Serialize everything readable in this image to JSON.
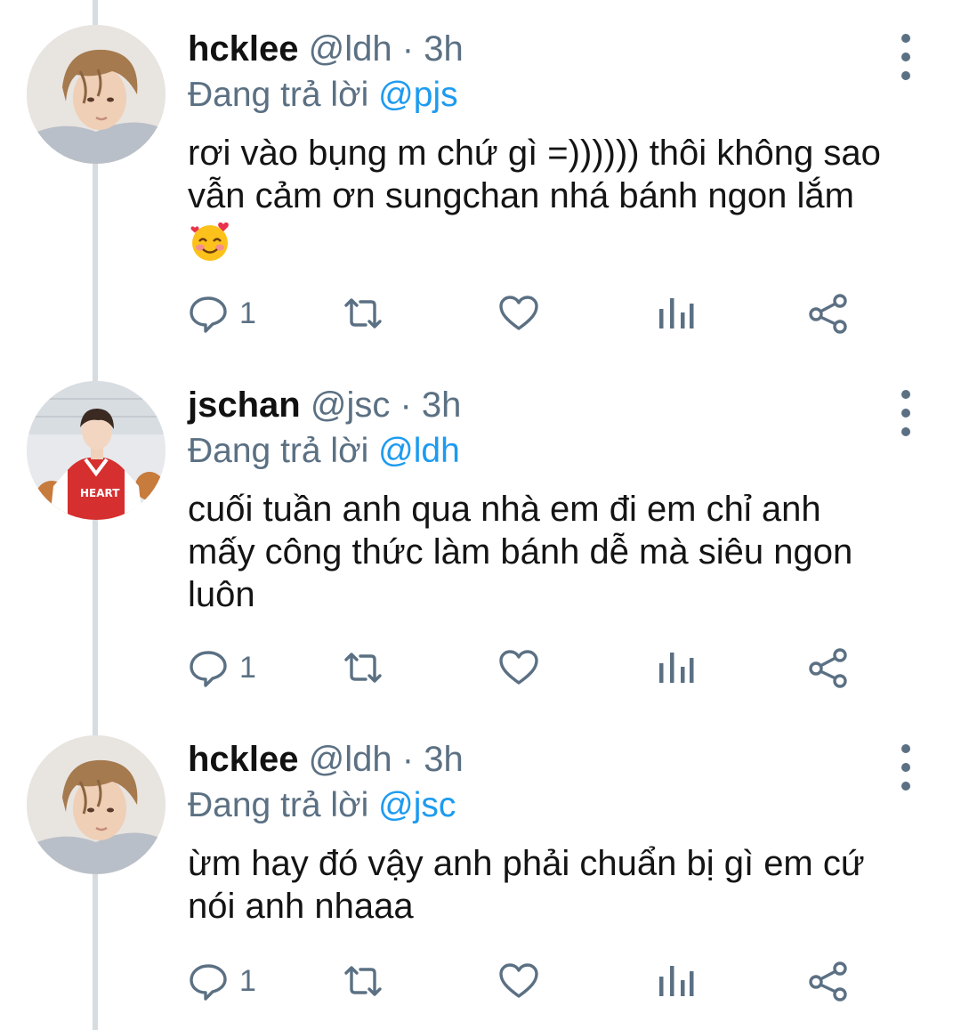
{
  "colors": {
    "link": "#1d9bf0",
    "secondary": "#5b7083",
    "thread_line": "#d6dce0"
  },
  "tweets": [
    {
      "name": "hcklee",
      "handle": "@ldh",
      "separator": "·",
      "time": "3h",
      "replying_prefix": "Đang trả lời",
      "replying_to": "@pjs",
      "lines": [
        "rơi vào bụng m chứ gì =)))))) thôi không sao",
        "vẫn cảm ơn sungchan nhá bánh ngon lắm"
      ],
      "emoji": "smiling-face-with-hearts",
      "reply_count": "1",
      "avatar": "avatar-hcklee"
    },
    {
      "name": "jschan",
      "handle": "@jsc",
      "separator": "·",
      "time": "3h",
      "replying_prefix": "Đang trả lời",
      "replying_to": "@ldh",
      "lines": [
        "cuối tuần anh qua nhà em đi em chỉ anh",
        "mấy công thức làm bánh dễ mà siêu ngon",
        "luôn"
      ],
      "reply_count": "1",
      "avatar": "avatar-jschan"
    },
    {
      "name": "hcklee",
      "handle": "@ldh",
      "separator": "·",
      "time": "3h",
      "replying_prefix": "Đang trả lời",
      "replying_to": "@jsc",
      "lines": [
        "ừm hay đó vậy anh phải chuẩn bị gì em cứ",
        "nói anh nhaaa"
      ],
      "reply_count": "1",
      "avatar": "avatar-hcklee"
    }
  ],
  "icons": [
    "reply-icon",
    "retweet-icon",
    "like-icon",
    "analytics-icon",
    "share-icon",
    "more-options-icon"
  ]
}
